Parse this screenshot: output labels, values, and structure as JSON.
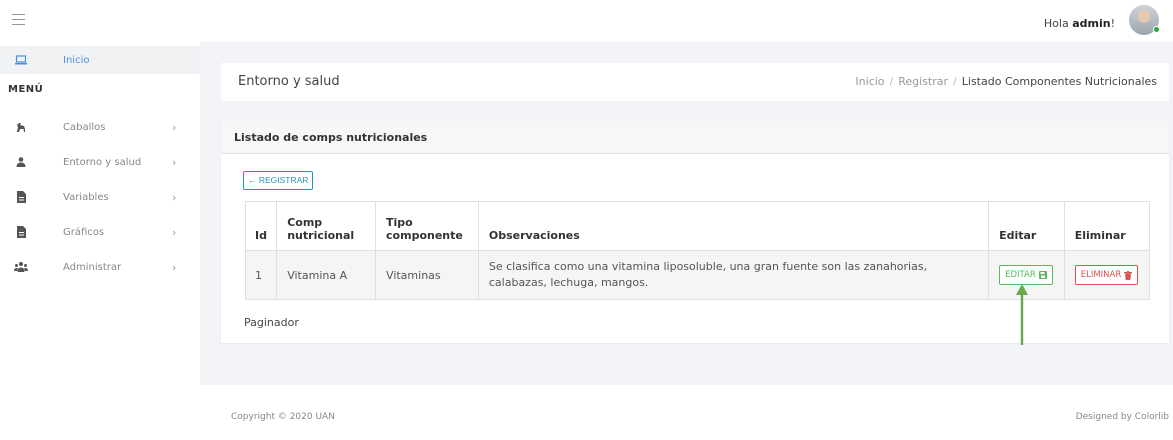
{
  "header": {
    "greeting_prefix": "Hola ",
    "user": "admin",
    "greeting_suffix": "!"
  },
  "sidebar": {
    "active_item": "Inicio",
    "menu_heading": "MENÚ",
    "items": [
      {
        "label": "Caballos",
        "icon": "horse-icon"
      },
      {
        "label": "Entorno y salud",
        "icon": "person-icon"
      },
      {
        "label": "Variables",
        "icon": "document-icon"
      },
      {
        "label": "Gráficos",
        "icon": "document-icon"
      },
      {
        "label": "Administrar",
        "icon": "users-icon"
      }
    ],
    "chevron": "›"
  },
  "page": {
    "title": "Entorno y salud",
    "breadcrumb": [
      "Inicio",
      "Registrar",
      "Listado Componentes Nutricionales"
    ],
    "breadcrumb_sep": "/"
  },
  "card": {
    "title": "Listado de comps nutricionales",
    "register_button": "← REGISTRAR",
    "table": {
      "headers": {
        "id": "Id",
        "comp": "Comp nutricional",
        "tipo": "Tipo componente",
        "obs": "Observaciones",
        "editar": "Editar",
        "eliminar": "Eliminar"
      },
      "rows": [
        {
          "id": "1",
          "comp": "Vitamina A",
          "tipo": "Vitaminas",
          "obs": "Se clasifica como una vitamina liposoluble, una gran fuente son las zanahorias, calabazas, lechuga, mangos.",
          "edit_label": "EDITAR",
          "delete_label": "ELIMINAR"
        }
      ]
    },
    "paginator": "Paginador"
  },
  "footer": {
    "copyright": "Copyright © 2020 UAN",
    "designed": "Designed by Colorlib"
  },
  "colors": {
    "accent": "#4a90e2",
    "register": "#2a93b5",
    "edit": "#5cb85c",
    "delete": "#d9534f",
    "arrow": "#6aa84f"
  }
}
